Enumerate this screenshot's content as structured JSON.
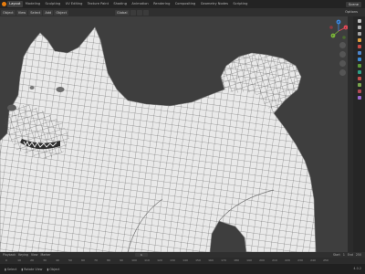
{
  "app": {
    "tabs": [
      "Layout",
      "Modeling",
      "Sculpting",
      "UV Editing",
      "Texture Paint",
      "Shading",
      "Animation",
      "Rendering",
      "Compositing",
      "Geometry Nodes",
      "Scripting"
    ],
    "active_tab_index": 0,
    "scene_label": "Scene",
    "logo_icon": "blender-logo-icon",
    "accent_color": "#e87d0d"
  },
  "header": {
    "mode": "Object",
    "view_menu": "View",
    "select_menu": "Select",
    "add_menu": "Add",
    "object_menu": "Object",
    "orientation": "Global",
    "options_label": "Options"
  },
  "viewport": {
    "subject": "quad-remeshed dog model",
    "mesh_color": "#e9e9e9",
    "wire_color": "#4a4a4a"
  },
  "gizmo": {
    "x_label": "X",
    "y_label": "Y",
    "z_label": "Z",
    "x_color": "#e84d5b",
    "y_color": "#7bb53b",
    "z_color": "#3c88e0"
  },
  "timeline": {
    "playback": "Playback",
    "keying": "Keying",
    "view": "View",
    "marker": "Marker",
    "current_frame": "1",
    "start_label": "Start",
    "start": "1",
    "end_label": "End",
    "end": "250",
    "ruler": [
      "0",
      "10",
      "20",
      "30",
      "40",
      "50",
      "60",
      "70",
      "80",
      "90",
      "100",
      "110",
      "120",
      "130",
      "140",
      "150",
      "160",
      "170",
      "180",
      "190",
      "200",
      "210",
      "220",
      "230",
      "240",
      "250"
    ]
  },
  "status": {
    "select": "Select",
    "rotate_view": "Rotate View",
    "object": "Object",
    "version": "4.0.2"
  }
}
